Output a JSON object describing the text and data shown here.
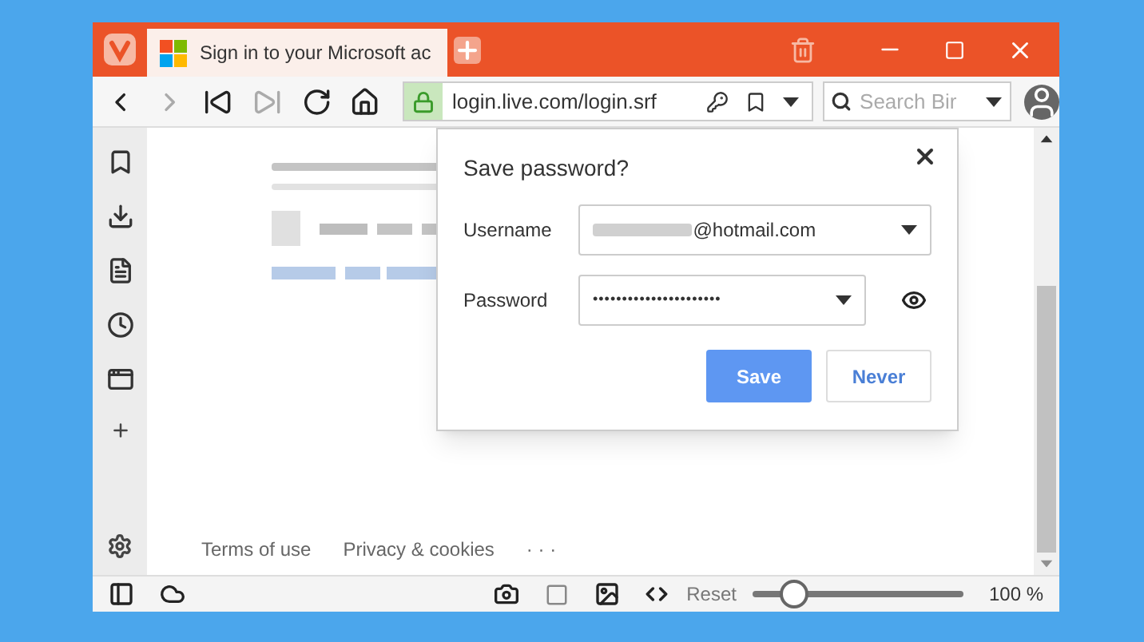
{
  "tab": {
    "title": "Sign in to your Microsoft ac",
    "selected": true
  },
  "nav_buttons": [
    {
      "kind": "back",
      "disabled": false
    },
    {
      "kind": "forward",
      "disabled": true
    },
    {
      "kind": "rewind",
      "disabled": false
    },
    {
      "kind": "fastforward",
      "disabled": true
    },
    {
      "kind": "reload",
      "disabled": false
    },
    {
      "kind": "home",
      "disabled": false
    }
  ],
  "address": {
    "url": "login.live.com/login.srf"
  },
  "search": {
    "placeholder": "Search Bir"
  },
  "sidebar": {
    "panels": [
      {
        "kind": "bookmarks"
      },
      {
        "kind": "downloads"
      },
      {
        "kind": "notes"
      },
      {
        "kind": "history"
      },
      {
        "kind": "window"
      },
      {
        "kind": "add"
      }
    ]
  },
  "page": {
    "footer_links": [
      "Terms of use",
      "Privacy & cookies",
      "· · ·"
    ]
  },
  "dialog": {
    "title": "Save password?",
    "username_label": "Username",
    "username": "@hotmail.com",
    "password_label": "Password",
    "password": "••••••••••••••••••••••",
    "buttons": [
      {
        "label": "Save",
        "kind": "primary"
      },
      {
        "label": "Never",
        "kind": "secondary"
      }
    ]
  },
  "status_bar": {
    "reset": "Reset",
    "zoom": {
      "level": 0.2
    },
    "zoom_reading": "100 %"
  }
}
